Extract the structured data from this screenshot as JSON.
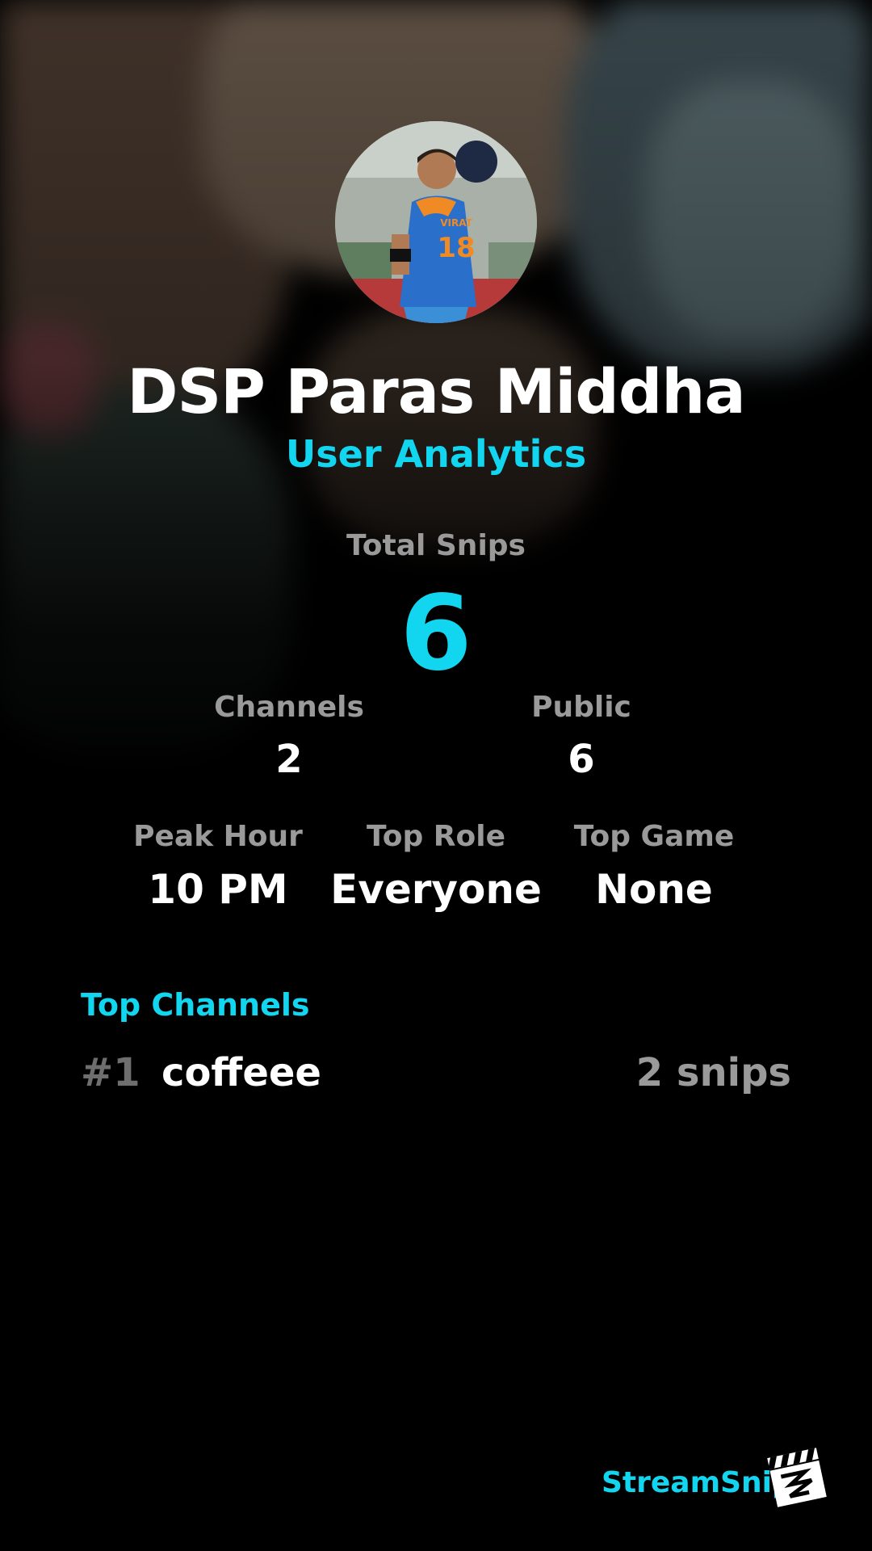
{
  "profile": {
    "name": "DSP Paras Middha",
    "subtitle": "User Analytics",
    "jersey_text": "VIRAT",
    "jersey_number": "18"
  },
  "stats": {
    "total_snips_label": "Total Snips",
    "total_snips_value": "6",
    "channels_label": "Channels",
    "channels_value": "2",
    "public_label": "Public",
    "public_value": "6",
    "peak_hour_label": "Peak Hour",
    "peak_hour_value": "10 PM",
    "top_role_label": "Top Role",
    "top_role_value": "Everyone",
    "top_game_label": "Top Game",
    "top_game_value": "None"
  },
  "top_channels": {
    "title": "Top Channels",
    "items": [
      {
        "rank": "#1",
        "name": "coffeee",
        "count": "2 snips"
      }
    ]
  },
  "footer": {
    "brand": "StreamSnip",
    "logo_icon": "clapperboard-icon"
  },
  "colors": {
    "accent": "#12d6f0",
    "background": "#000000",
    "label": "#9a9a9a",
    "text": "#ffffff"
  }
}
